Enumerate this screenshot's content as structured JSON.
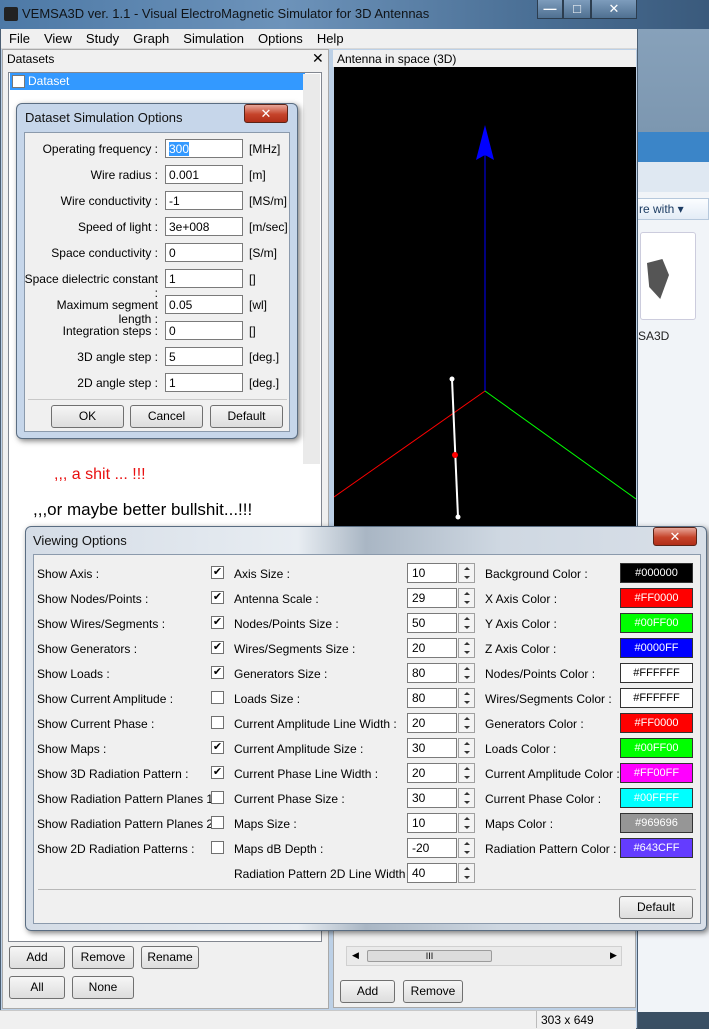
{
  "window": {
    "title": "VEMSA3D ver. 1.1 - Visual ElectroMagnetic Simulator for 3D Antennas",
    "min": "—",
    "max": "□",
    "close": "✕"
  },
  "menu": [
    "File",
    "View",
    "Study",
    "Graph",
    "Simulation",
    "Options",
    "Help"
  ],
  "datasets": {
    "header": "Datasets",
    "close": "✕",
    "row": "Dataset",
    "text1": ",,, a shit ... !!!",
    "text2": ",,,or maybe better bullshit...!!!",
    "buttons": {
      "add": "Add",
      "remove": "Remove",
      "rename": "Rename",
      "all": "All",
      "none": "None"
    }
  },
  "view3d": {
    "header": "Antenna in space (3D)",
    "scroll_grip": "III",
    "buttons": {
      "add": "Add",
      "remove": "Remove"
    }
  },
  "status": {
    "size": "303 x 649"
  },
  "desktop": {
    "rewith": "re with ▾",
    "label": "SA3D"
  },
  "colors": {
    "titlebar": "#4d79a6",
    "selection": "#3399ff",
    "close_red": "#c5432a",
    "axis_x": "#ff0000",
    "axis_y": "#00ff00",
    "axis_z": "#0000ff"
  },
  "sim_dialog": {
    "title": "Dataset Simulation Options",
    "close": "✕",
    "fields": [
      {
        "label": "Operating frequency :",
        "value": "300",
        "unit": "[MHz]"
      },
      {
        "label": "Wire radius :",
        "value": "0.001",
        "unit": "[m]"
      },
      {
        "label": "Wire conductivity :",
        "value": "-1",
        "unit": "[MS/m]"
      },
      {
        "label": "Speed of light :",
        "value": "3e+008",
        "unit": "[m/sec]"
      },
      {
        "label": "Space conductivity :",
        "value": "0",
        "unit": "[S/m]"
      },
      {
        "label": "Space dielectric constant :",
        "value": "1",
        "unit": "[]"
      },
      {
        "label": "Maximum segment length :",
        "value": "0.05",
        "unit": "[wl]"
      },
      {
        "label": "Integration steps :",
        "value": "0",
        "unit": "[]"
      },
      {
        "label": "3D angle step :",
        "value": "5",
        "unit": "[deg.]"
      },
      {
        "label": "2D angle step :",
        "value": "1",
        "unit": "[deg.]"
      }
    ],
    "buttons": {
      "ok": "OK",
      "cancel": "Cancel",
      "default": "Default"
    }
  },
  "view_dialog": {
    "title": "Viewing Options",
    "close": "✕",
    "checks": [
      {
        "label": "Show Axis :",
        "checked": true,
        "mark": "✔"
      },
      {
        "label": "Show Nodes/Points :",
        "checked": true,
        "mark": "✔"
      },
      {
        "label": "Show Wires/Segments :",
        "checked": true,
        "mark": "✔"
      },
      {
        "label": "Show Generators :",
        "checked": true,
        "mark": "✔"
      },
      {
        "label": "Show Loads :",
        "checked": true,
        "mark": "✔"
      },
      {
        "label": "Show Current Amplitude :",
        "checked": false,
        "mark": ""
      },
      {
        "label": "Show Current Phase :",
        "checked": false,
        "mark": ""
      },
      {
        "label": "Show Maps :",
        "checked": true,
        "mark": "✔"
      },
      {
        "label": "Show 3D Radiation Pattern :",
        "checked": true,
        "mark": "✔"
      },
      {
        "label": "Show Radiation Pattern Planes 1 :",
        "checked": false,
        "mark": ""
      },
      {
        "label": "Show Radiation Pattern Planes 2 :",
        "checked": false,
        "mark": ""
      },
      {
        "label": "Show 2D Radiation Patterns :",
        "checked": false,
        "mark": ""
      }
    ],
    "sizes": [
      {
        "label": "Axis Size :",
        "value": "10"
      },
      {
        "label": "Antenna Scale :",
        "value": "29"
      },
      {
        "label": "Nodes/Points Size :",
        "value": "50"
      },
      {
        "label": "Wires/Segments Size :",
        "value": "20"
      },
      {
        "label": "Generators Size :",
        "value": "80"
      },
      {
        "label": "Loads Size :",
        "value": "80"
      },
      {
        "label": "Current Amplitude Line Width :",
        "value": "20"
      },
      {
        "label": "Current Amplitude Size :",
        "value": "30"
      },
      {
        "label": "Current Phase Line Width :",
        "value": "20"
      },
      {
        "label": "Current Phase Size :",
        "value": "30"
      },
      {
        "label": "Maps Size :",
        "value": "10"
      },
      {
        "label": "Maps dB Depth :",
        "value": "-20"
      },
      {
        "label": "Radiation Pattern 2D Line Width :",
        "value": "40"
      }
    ],
    "colorsList": [
      {
        "label": "Background Color :",
        "value": "#000000",
        "text": "#ffffff"
      },
      {
        "label": "X Axis Color :",
        "value": "#FF0000",
        "text": "#ffffff"
      },
      {
        "label": "Y Axis Color :",
        "value": "#00FF00",
        "text": "#ffffff"
      },
      {
        "label": "Z Axis Color :",
        "value": "#0000FF",
        "text": "#ffffff"
      },
      {
        "label": "Nodes/Points Color :",
        "value": "#FFFFFF",
        "text": "#000000"
      },
      {
        "label": "Wires/Segments Color :",
        "value": "#FFFFFF",
        "text": "#000000"
      },
      {
        "label": "Generators Color :",
        "value": "#FF0000",
        "text": "#ffffff"
      },
      {
        "label": "Loads Color :",
        "value": "#00FF00",
        "text": "#ffffff"
      },
      {
        "label": "Current Amplitude Color :",
        "value": "#FF00FF",
        "text": "#ffffff"
      },
      {
        "label": "Current Phase Color :",
        "value": "#00FFFF",
        "text": "#ffffff"
      },
      {
        "label": "Maps Color :",
        "value": "#969696",
        "text": "#ffffff"
      },
      {
        "label": "Radiation Pattern Color :",
        "value": "#643CFF",
        "text": "#ffffff"
      }
    ],
    "default": "Default"
  }
}
